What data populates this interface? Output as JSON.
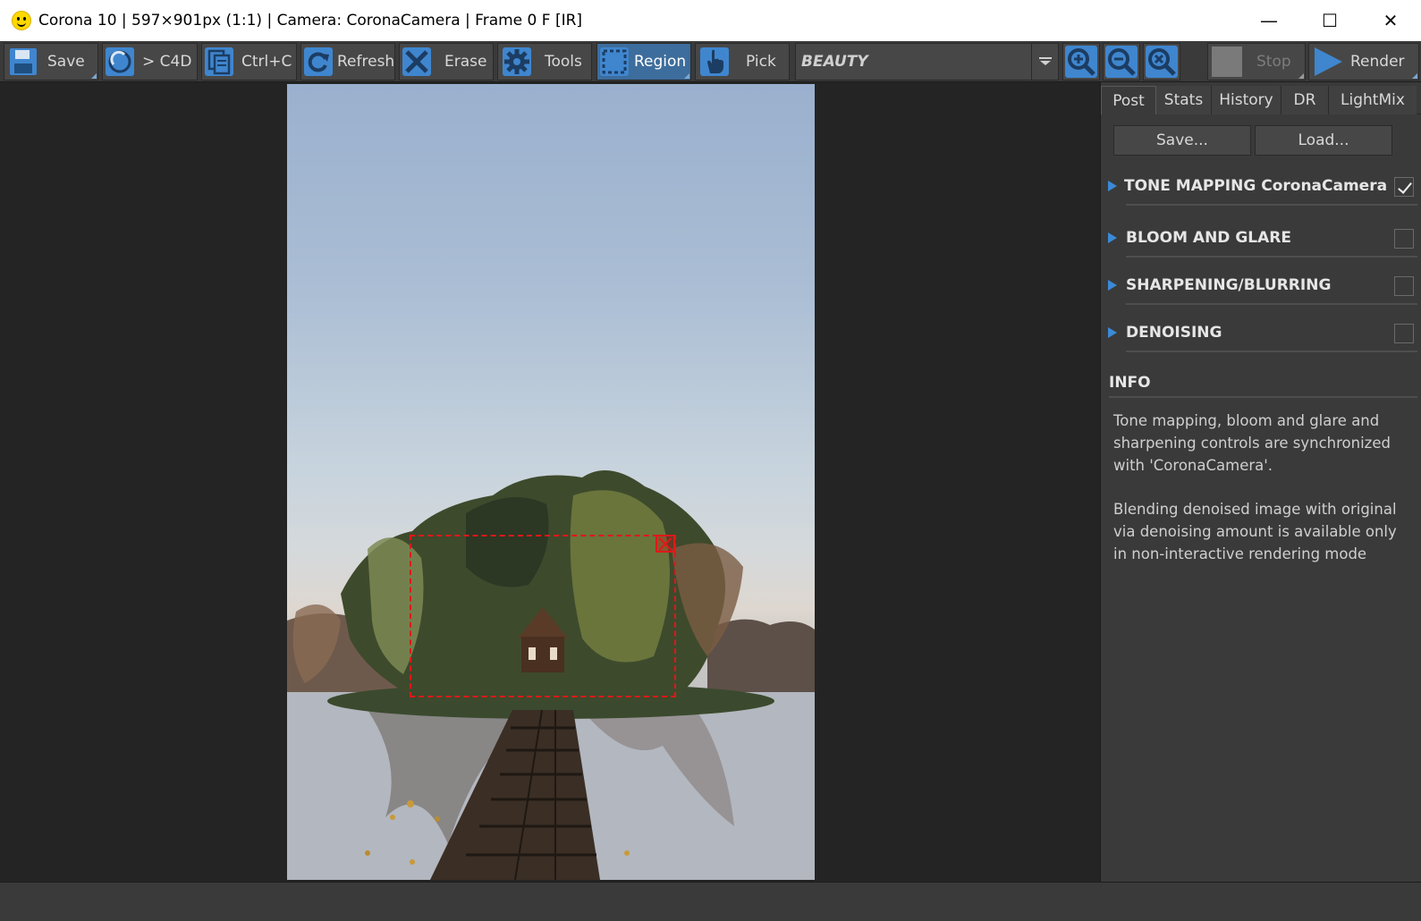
{
  "window": {
    "title": "Corona 10 | 597×901px (1:1) | Camera: CoronaCamera | Frame 0 F [IR]",
    "minimize": "—",
    "maximize": "☐",
    "close": "✕"
  },
  "toolbar": {
    "save": "Save",
    "c4d": "> C4D",
    "copy": "Ctrl+C",
    "refresh": "Refresh",
    "erase": "Erase",
    "tools": "Tools",
    "region": "Region",
    "pick": "Pick",
    "channel": "BEAUTY",
    "stop": "Stop",
    "render": "Render"
  },
  "panel": {
    "tabs": [
      "Post",
      "Stats",
      "History",
      "DR",
      "LightMix"
    ],
    "active_tab": "Post",
    "save_btn": "Save...",
    "load_btn": "Load...",
    "sections": [
      {
        "title": "TONE MAPPING CoronaCamera",
        "checked": true
      },
      {
        "title": "BLOOM AND GLARE",
        "checked": false
      },
      {
        "title": "SHARPENING/BLURRING",
        "checked": false
      },
      {
        "title": "DENOISING",
        "checked": false
      }
    ],
    "info_title": "INFO",
    "info_p1": "Tone mapping, bloom and glare and sharpening controls are synchronized with 'CoronaCamera'.",
    "info_p2": "Blending denoised image with original via denoising amount is available only in non-interactive rendering mode"
  },
  "colors": {
    "accent": "#3a8ad8",
    "active_button": "#3d6d9c",
    "region_border": "#e01818"
  }
}
